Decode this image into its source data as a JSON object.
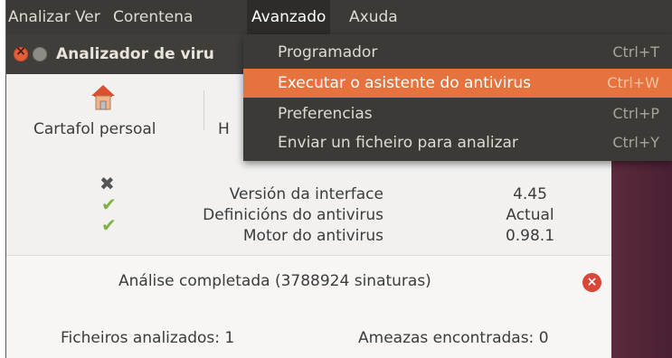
{
  "menubar": {
    "items": [
      {
        "label": "Analizar"
      },
      {
        "label": "Ver"
      },
      {
        "label": "Corentena"
      },
      {
        "label": "Avanzado"
      },
      {
        "label": "Axuda"
      }
    ]
  },
  "window": {
    "title": "Analizador de viru"
  },
  "toolbar": {
    "home_label": "Cartafol persoal",
    "partial_label": "H"
  },
  "status": {
    "rows": [
      {
        "label": "Versión da interface",
        "value": "4.45",
        "icon": "x-mark-icon"
      },
      {
        "label": "Definicións do antivirus",
        "value": "Actual",
        "icon": "checkmark-icon"
      },
      {
        "label": "Motor do antivirus",
        "value": "0.98.1",
        "icon": "checkmark-icon"
      }
    ]
  },
  "scan": {
    "status_text": "Análise completada (3788924 sinaturas)",
    "files_scanned": "Ficheiros analizados: 1",
    "threats_found": "Ameazas encontradas: 0"
  },
  "dropdown": {
    "items": [
      {
        "label": "Programador",
        "accel": "Ctrl+T"
      },
      {
        "label": "Executar o asistente do antivirus",
        "accel": "Ctrl+W"
      },
      {
        "label": "Preferencias",
        "accel": "Ctrl+P"
      },
      {
        "label": "Enviar un ficheiro para analizar",
        "accel": "Ctrl+Y"
      }
    ],
    "highlighted_index": 1
  },
  "colors": {
    "menubar_bg": "#3b3a36",
    "highlight": "#e6723d",
    "window_bg": "#f2f1f0",
    "close_button": "#d9463a",
    "check_green": "#7cb342",
    "desktop_bg": "#5b2a3e"
  }
}
